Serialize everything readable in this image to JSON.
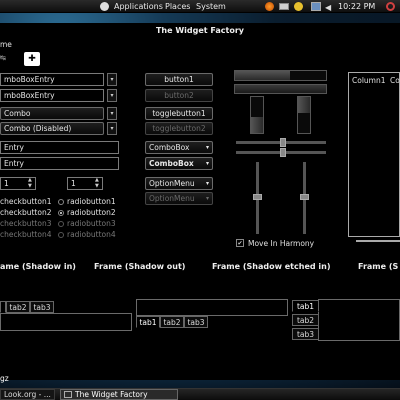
{
  "top_panel": {
    "menus": [
      "Applications",
      "Places",
      "System"
    ],
    "clock": "10:22 PM"
  },
  "window": {
    "title": "The Widget Factory",
    "partial_label": "me"
  },
  "left_column": {
    "combo_entries": [
      "mboBoxEntry",
      "mboBoxEntry"
    ],
    "combo_box": "Combo",
    "combo_disabled": "Combo (Disabled)",
    "entries": [
      "Entry",
      "Entry"
    ],
    "spin_values": [
      "1",
      "1"
    ],
    "checkbuttons": [
      "checkbutton1",
      "checkbutton2",
      "checkbutton3",
      "checkbutton4"
    ],
    "radiobuttons": [
      "radiobutton1",
      "radiobutton2",
      "radiobutton3",
      "radiobutton4"
    ]
  },
  "middle_column": {
    "button1": "button1",
    "button2": "button2",
    "togglebutton1": "togglebutton1",
    "togglebutton2": "togglebutton2",
    "combobox_1": "ComboBox",
    "combobox_2": "ComboBox",
    "optionmenu_1": "OptionMenu",
    "optionmenu_2": "OptionMenu"
  },
  "right_column": {
    "move_in_harmony": "Move In Harmony"
  },
  "treeview": {
    "columns": [
      "Column1",
      "Co"
    ]
  },
  "frames": {
    "labels": [
      "ame (Shadow in)",
      "Frame (Shadow out)",
      "Frame (Shadow etched in)",
      "Frame (S"
    ]
  },
  "notebooks": {
    "nb1_tabs": [
      "tab2",
      "tab3"
    ],
    "nb2_tabs": [
      "tab1",
      "tab2",
      "tab3"
    ],
    "nb3_tabs": [
      "tab1",
      "tab2",
      "tab3"
    ]
  },
  "bottom_partial": "gz",
  "taskbar": {
    "items": [
      "Look.org - ...",
      "The Widget Factory"
    ]
  }
}
